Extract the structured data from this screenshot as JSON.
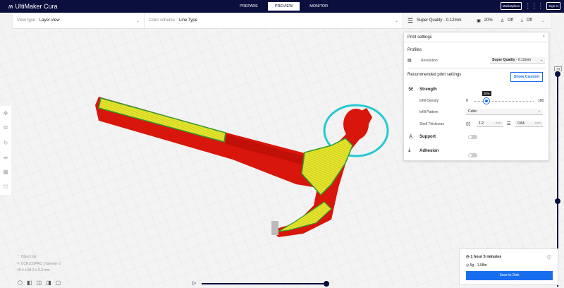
{
  "app": {
    "title": "UltiMaker Cura"
  },
  "stages": [
    "PREPARE",
    "PREVIEW",
    "MONITOR"
  ],
  "header": {
    "marketplace": "Marketplace",
    "signin": "Sign in"
  },
  "toolbar": {
    "view_type_label": "View type",
    "view_type": "Layer view",
    "color_scheme_label": "Color scheme",
    "color_scheme": "Line Type",
    "profile": "Super Quality - 0.12mm",
    "infill": "20%",
    "support": "Off",
    "adhesion": "Off"
  },
  "print_settings": {
    "title": "Print settings",
    "profiles": "Profiles",
    "resolution_label": "Resolution",
    "resolution_bold": "Super Quality",
    "resolution_rest": " - 0.12mm",
    "recommended": "Recommended print settings",
    "show_custom": "Show Custom",
    "strength": "Strength",
    "infill_density": "Infill Density",
    "infill_min": "0",
    "infill_max": "100",
    "infill_value": "20%",
    "infill_fraction": 0.2,
    "infill_pattern_label": "Infill Pattern",
    "infill_pattern": "Cubic",
    "shell_label": "Shell Thickness",
    "wall": "1.2",
    "top_bottom": "0.84",
    "unit": "mm",
    "support": "Support",
    "adhesion": "Adhesion"
  },
  "layer_slider": {
    "value": "74"
  },
  "object": {
    "list": "Object list",
    "name": "CCR10SPRO_Hammer 1",
    "dims": "40.4 x 84.2 x 5.3 mm"
  },
  "estimate": {
    "time": "1 hour 5 minutes",
    "material": "5g · 1.98m",
    "save": "Save to Disk"
  },
  "colors": {
    "nav": "#0a0f3d",
    "accent": "#196ef0",
    "wall": "#e0190f",
    "infill": "#e6e62e",
    "skirt": "#28c8d2"
  }
}
